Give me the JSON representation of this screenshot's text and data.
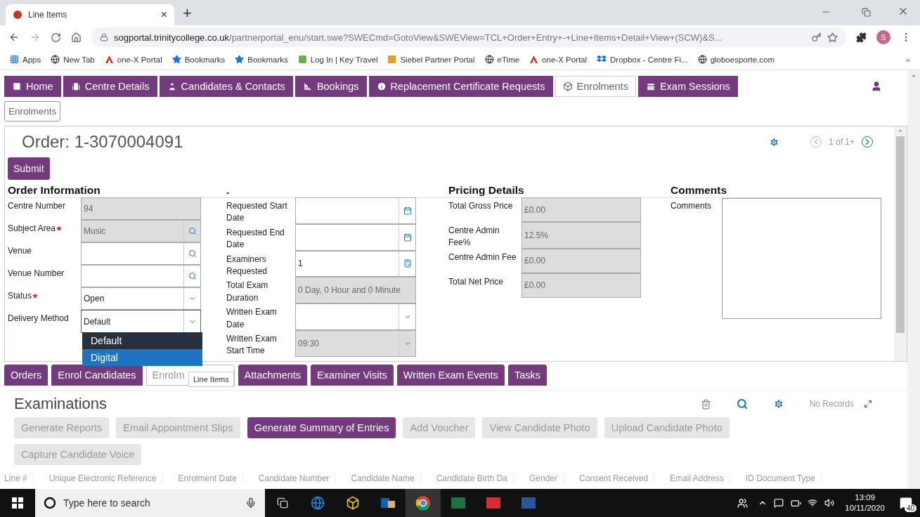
{
  "browser": {
    "tab_title": "Line Items",
    "tab_close": "×",
    "new_tab": "+",
    "url_host": "sogportal.trinitycollege.co.uk",
    "url_path": "/partnerportal_enu/start.swe?SWECmd=GotoView&SWEView=TCL+Order+Entry+-+Line+Items+Detail+View+(SCW)&S...",
    "profile": "S",
    "bookmarks": [
      {
        "label": "Apps",
        "kind": "apps"
      },
      {
        "label": "New Tab",
        "kind": "globe"
      },
      {
        "label": "one-X Portal",
        "kind": "logo"
      },
      {
        "label": "Bookmarks",
        "kind": "star"
      },
      {
        "label": "Bookmarks",
        "kind": "star"
      },
      {
        "label": "Log In | Key Travel",
        "kind": "key"
      },
      {
        "label": "Siebel Partner Portal",
        "kind": "siebel"
      },
      {
        "label": "eTime",
        "kind": "globe"
      },
      {
        "label": "one-X Portal",
        "kind": "logo"
      },
      {
        "label": "Dropbox - Centre Fi...",
        "kind": "dropbox"
      },
      {
        "label": "globoesporte.com",
        "kind": "globe"
      }
    ],
    "more": "»"
  },
  "nav": [
    {
      "label": "Home",
      "selected": false
    },
    {
      "label": "Centre Details",
      "selected": false
    },
    {
      "label": "Candidates & Contacts",
      "selected": false
    },
    {
      "label": "Bookings",
      "selected": false
    },
    {
      "label": "Replacement Certificate Requests",
      "selected": false
    },
    {
      "label": "Enrolments",
      "selected": true
    },
    {
      "label": "Exam Sessions",
      "selected": false
    }
  ],
  "subnav": "Enrolments",
  "order": {
    "title": "Order: 1-3070004091",
    "submit": "Submit",
    "pager": "1 of 1+",
    "columns": [
      {
        "heading": "Order Information",
        "fields": [
          {
            "label": "Centre Number",
            "value": "94",
            "kind": "text",
            "disabled": true,
            "focused": false
          },
          {
            "label": "Subject Area",
            "required_mark": "★",
            "value": "Music",
            "kind": "lookup",
            "disabled": true,
            "focused": false
          },
          {
            "label": "Venue",
            "kind": "lookup",
            "disabled": false,
            "focused": false
          },
          {
            "label": "Venue Number",
            "kind": "lookup",
            "disabled": false,
            "focused": false
          },
          {
            "label": "Status",
            "required_mark": "★",
            "value": "Open",
            "kind": "select",
            "disabled": false,
            "focused": false
          },
          {
            "label": "Delivery Method",
            "value": "Default",
            "kind": "select",
            "disabled": false,
            "focused": true
          }
        ]
      },
      {
        "heading": ".",
        "fields": [
          {
            "label": "Requested Start Date",
            "kind": "date",
            "disabled": false,
            "focused": false
          },
          {
            "label": "Requested End Date",
            "kind": "date",
            "disabled": false,
            "focused": false
          },
          {
            "label": "Examiners Requested",
            "value": "1",
            "kind": "calculator",
            "disabled": false,
            "focused": false
          },
          {
            "label": "Total Exam Duration",
            "value": "0 Day, 0 Hour and 0 Minute",
            "kind": "text",
            "disabled": true,
            "focused": false
          },
          {
            "label": "Written Exam Date",
            "kind": "select",
            "disabled": false,
            "focused": false
          },
          {
            "label": "Written Exam Start Time",
            "value": "09:30",
            "kind": "select",
            "disabled": true,
            "focused": false
          }
        ]
      },
      {
        "heading": "Pricing Details",
        "fields": [
          {
            "label": "Total Gross Price",
            "value": "£0.00",
            "kind": "text",
            "disabled": true,
            "focused": false
          },
          {
            "label": "Centre Admin Fee%",
            "value": "12.5%",
            "kind": "text",
            "disabled": true,
            "focused": false
          },
          {
            "label": "Centre Admin Fee",
            "value": "£0.00",
            "kind": "text",
            "disabled": true,
            "focused": false
          },
          {
            "label": "Total Net Price",
            "value": "£0.00",
            "kind": "text",
            "disabled": true,
            "focused": false
          }
        ]
      }
    ],
    "comments": {
      "heading": "Comments",
      "label": "Comments"
    },
    "dropdown": [
      {
        "label": "Default",
        "highlighted": false
      },
      {
        "label": "Digital",
        "highlighted": true
      }
    ]
  },
  "tabs": [
    {
      "label": "Orders",
      "selected": false
    },
    {
      "label": "Enrol Candidates",
      "selected": false
    },
    {
      "label": "Enrolm",
      "selected": true
    },
    {
      "label": "Attachments",
      "selected": false
    },
    {
      "label": "Examiner Visits",
      "selected": false
    },
    {
      "label": "Written Exam Events",
      "selected": false
    },
    {
      "label": "Tasks",
      "selected": false
    }
  ],
  "tooltip": "Line Items",
  "examinations": {
    "title": "Examinations",
    "record_count": "No Records",
    "buttons": [
      {
        "label": "Generate Reports",
        "disabled": true
      },
      {
        "label": "Email Appointment Slips",
        "disabled": true
      },
      {
        "label": "Generate Summary of Entries",
        "disabled": false
      },
      {
        "label": "Add Voucher",
        "disabled": true
      },
      {
        "label": "View Candidate Photo",
        "disabled": true
      },
      {
        "label": "Upload Candidate Photo",
        "disabled": true
      },
      {
        "label": "Capture Candidate Voice",
        "disabled": true
      }
    ],
    "columns": [
      "Line #",
      "Unique Electronic Reference",
      "Enrolment Date",
      "Candidate Number",
      "Candidate Name",
      "Candidate Birth Da",
      "Gender",
      "Consent Received",
      "Email Address",
      "ID Document Type"
    ]
  },
  "taskbar": {
    "search_placeholder": "Type here to search",
    "time": "13:09",
    "date": "10/11/2020",
    "notifications": "40"
  }
}
